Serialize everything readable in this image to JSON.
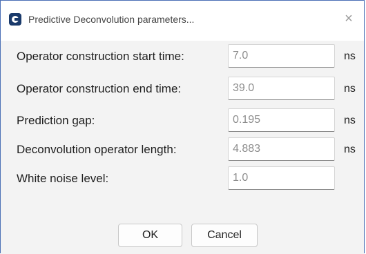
{
  "window": {
    "title": "Predictive Deconvolution parameters...",
    "close_glyph": "×",
    "app_icon": "app-logo-icon"
  },
  "form": {
    "rows": [
      {
        "label": "Operator construction start time:",
        "value": "7.0",
        "unit": "ns"
      },
      {
        "label": "Operator construction end time:",
        "value": "39.0",
        "unit": "ns"
      },
      {
        "label": "Prediction gap:",
        "value": "0.195",
        "unit": "ns"
      },
      {
        "label": "Deconvolution operator length:",
        "value": "4.883",
        "unit": "ns"
      },
      {
        "label": "White noise level:",
        "value": "1.0",
        "unit": ""
      }
    ]
  },
  "buttons": {
    "ok_label": "OK",
    "cancel_label": "Cancel"
  }
}
